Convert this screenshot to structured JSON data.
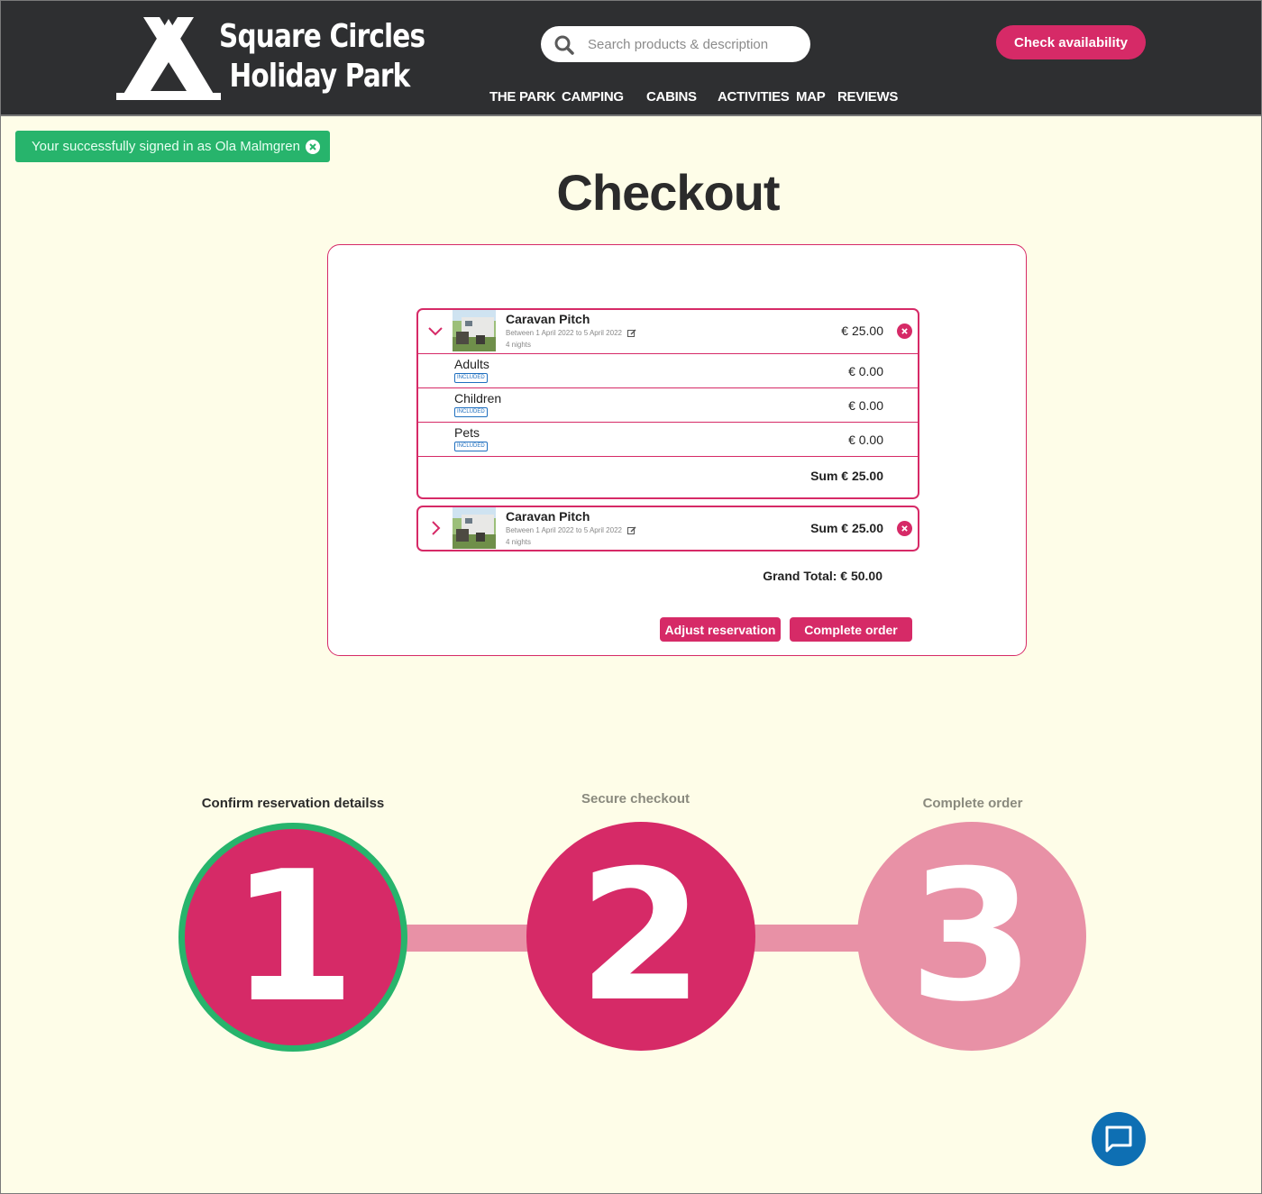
{
  "header": {
    "logo_line1": "Square Circles",
    "logo_line2": "Holiday Park",
    "search_placeholder": "Search products & description",
    "check_availability": "Check availability",
    "nav": [
      "THE PARK",
      "CAMPING",
      "CABINS",
      "ACTIVITIES",
      "MAP",
      "REVIEWS"
    ]
  },
  "toast": {
    "message": "Your successfully signed in as Ola Malmgren"
  },
  "page_title": "Checkout",
  "cart": {
    "items": [
      {
        "title": "Caravan Pitch",
        "dates": "Between 1 April 2022 to 5 April 2022",
        "nights": "4 nights",
        "price": "€ 25.00",
        "expanded": true,
        "lines": [
          {
            "label": "Adults",
            "badge": "INCLUDED",
            "price": "€ 0.00"
          },
          {
            "label": "Children",
            "badge": "INCLUDED",
            "price": "€ 0.00"
          },
          {
            "label": "Pets",
            "badge": "INCLUDED",
            "price": "€ 0.00"
          }
        ],
        "sum": "Sum € 25.00"
      },
      {
        "title": "Caravan Pitch",
        "dates": "Between 1 April 2022 to 5 April 2022",
        "nights": "4 nights",
        "price": "Sum € 25.00",
        "expanded": false
      }
    ],
    "grand_total": "Grand Total: € 50.00",
    "adjust_label": "Adjust reservation",
    "complete_label": "Complete order"
  },
  "steps": [
    {
      "label": "Confirm reservation detailss",
      "number": "1",
      "state": "current"
    },
    {
      "label": "Secure checkout",
      "number": "2",
      "state": "next"
    },
    {
      "label": "Complete order",
      "number": "3",
      "state": "future"
    }
  ],
  "colors": {
    "brand": "#d62a67",
    "header_bg": "#2e2f31",
    "page_bg": "#fefde8",
    "success": "#27b46c",
    "step_future": "#e891a6",
    "chat": "#0e6fb3"
  },
  "icons": [
    "search-icon",
    "close-icon",
    "chevron-down-icon",
    "chevron-right-icon",
    "edit-icon",
    "remove-icon",
    "chat-icon"
  ]
}
